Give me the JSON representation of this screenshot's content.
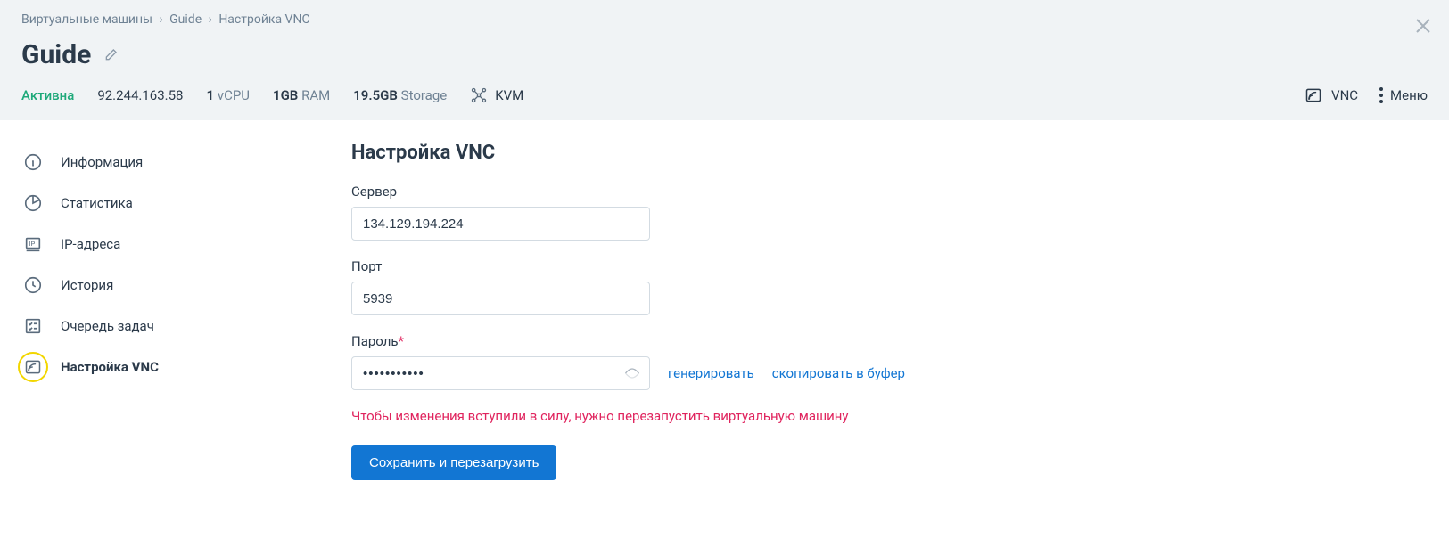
{
  "breadcrumb": {
    "root": "Виртуальные машины",
    "mid": "Guide",
    "leaf": "Настройка VNC"
  },
  "page": {
    "title": "Guide"
  },
  "status": {
    "label": "Активна"
  },
  "info": {
    "ip": "92.244.163.58",
    "cpu_count": "1",
    "cpu_label": "vCPU",
    "ram_value": "1GB",
    "ram_label": "RAM",
    "storage_value": "19.5GB",
    "storage_label": "Storage",
    "virt_label": "KVM"
  },
  "header_actions": {
    "vnc": "VNC",
    "menu": "Меню"
  },
  "sidebar": {
    "items": [
      {
        "label": "Информация"
      },
      {
        "label": "Статистика"
      },
      {
        "label": "IP-адреса"
      },
      {
        "label": "История"
      },
      {
        "label": "Очередь задач"
      },
      {
        "label": "Настройка VNC"
      }
    ]
  },
  "form": {
    "heading": "Настройка VNC",
    "server_label": "Сервер",
    "server_value": "134.129.194.224",
    "port_label": "Порт",
    "port_value": "5939",
    "password_label": "Пароль",
    "password_value": "•••••••••••",
    "generate_label": "генерировать",
    "copy_label": "скопировать в буфер",
    "warning": "Чтобы изменения вступили в силу, нужно перезапустить виртуальную машину",
    "submit_label": "Сохранить и перезагрузить"
  }
}
